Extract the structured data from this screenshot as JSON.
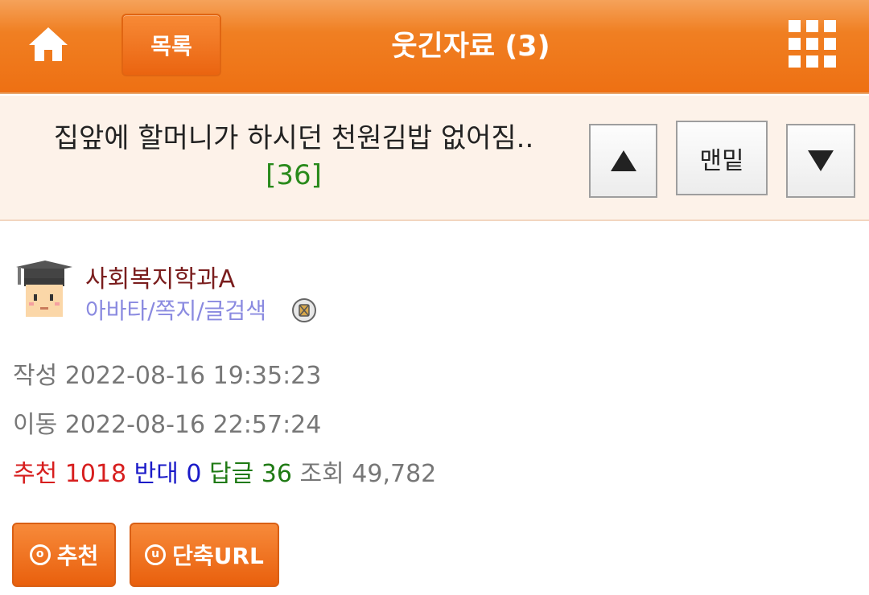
{
  "header": {
    "home_icon": "home-icon",
    "list_label": "목록",
    "title": "웃긴자료 (3)",
    "menu_icon": "grid-menu-icon"
  },
  "post": {
    "title": "집앞에 할머니가 하시던 천원김밥 없어짐..",
    "reply_count": "[36]"
  },
  "nav": {
    "up_icon": "arrow-up-icon",
    "bottom_label": "맨밑",
    "down_icon": "arrow-down-icon"
  },
  "author": {
    "name": "사회복지학과A",
    "links": "아바타/쪽지/글검색",
    "avatar_icon": "graduate-avatar-icon",
    "badge_icon": "member-badge-icon"
  },
  "meta": {
    "written": "작성 2022-08-16 19:35:23",
    "moved": "이동 2022-08-16 22:57:24"
  },
  "stats": {
    "recommend_label": "추천",
    "recommend_value": "1018",
    "oppose_label": "반대",
    "oppose_value": "0",
    "reply_label": "답글",
    "reply_value": "36",
    "views_label": "조회",
    "views_value": "49,782"
  },
  "actions": {
    "recommend_label": "추천",
    "recommend_icon_char": "o",
    "shorturl_label": "단축URL",
    "shorturl_icon_char": "u"
  },
  "colors": {
    "header_orange": "#ee7013",
    "title_bg": "#fdf2e9",
    "author_name": "#7a1d1d",
    "link_purple": "#8a8ae0",
    "recommend_red": "#d71e1e",
    "oppose_blue": "#1a1ac8",
    "reply_green": "#1f7a14"
  }
}
